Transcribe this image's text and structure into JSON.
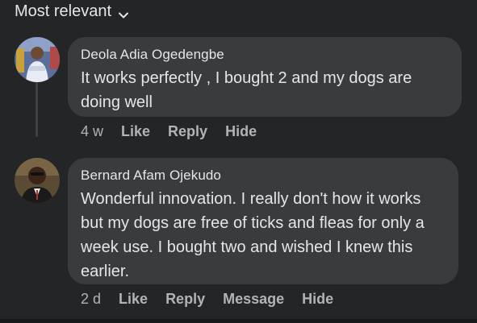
{
  "sort": {
    "label": "Most relevant"
  },
  "comments": [
    {
      "author": "Deola Adia Ogedengbe",
      "text": "It works perfectly , I bought 2 and my dogs are doing well",
      "time": "4 w",
      "actions": [
        "Like",
        "Reply",
        "Hide"
      ]
    },
    {
      "author": "Bernard Afam Ojekudo",
      "text": "Wonderful innovation.  I really don't how it works but my dogs are free of ticks and fleas for only a week use. I bought two and wished I knew this earlier.",
      "time": "2 d",
      "actions": [
        "Like",
        "Reply",
        "Message",
        "Hide"
      ]
    }
  ],
  "colors": {
    "background": "#242526",
    "bubble": "#3a3b3c",
    "text": "#e4e6eb",
    "secondary": "#b0b3b8"
  }
}
